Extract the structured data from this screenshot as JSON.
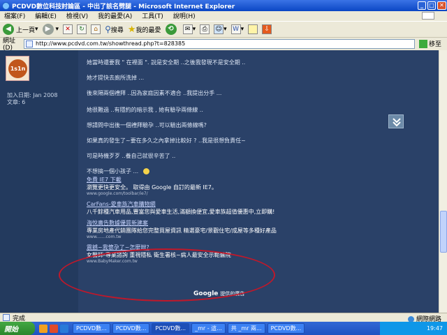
{
  "window": {
    "title": "PCDVD數位科技討論區 - 中出了該名劈腿 - Microsoft Internet Explorer"
  },
  "menu": [
    "檔案(F)",
    "編輯(E)",
    "檢視(V)",
    "我的最愛(A)",
    "工具(T)",
    "說明(H)"
  ],
  "toolbar": {
    "back": "上一頁",
    "search": "搜尋",
    "favorites": "我的最愛"
  },
  "address": {
    "label": "網址(D)",
    "url": "http://www.pcdvd.com.tw/showthread.php?t=828385",
    "go": "移至"
  },
  "user": {
    "join_date": "加入日期: Jan 2008",
    "posts": "文章: 6"
  },
  "post_lines": [
    "她當時還要我 \" 在裡面 \". 說是安全期 ..之後我發現不是安全期 ..",
    "她才提快去廁所洗掉 ...",
    "後來隔兩個禮拜 ..因為家庭因素不適合 ..我提出分手 ...",
    "她很難過 ..有隱約的暗示我 , 她有驗孕兩條線 ..",
    "想請問中出後一個禮拜驗孕 ..可以驗出兩條線嗎?",
    "如果真的發生了~要在多久之內拿掉比較好 ? ..我是很想負責任~",
    "可是時機歹歹 ..養自己就很辛苦了 ..",
    "不想搞一個小孩子 ..."
  ],
  "ads": [
    {
      "headline": "免費 IE7 下載",
      "desc": "瀏覽更快更安全。 取得由 Google 自訂的最新 IE7。",
      "url": "www.google.com/toolbar/ie7/"
    },
    {
      "headline": "CarFans-愛車族汽車購物網",
      "desc": "八千餘種汽車用品,豐富您與愛車生活,滿額換便宜,愛車族超值優惠中,立即購!",
      "url": ""
    },
    {
      "headline": "海悅廣告數據優質新建案",
      "desc": "專業房地產代銷團隊給您完整買屋資訊 精選豪宅/景觀住宅/成屋等多種好產品",
      "url": "www.......com.tw"
    },
    {
      "headline": "震撼~我懷孕了~怎麼辦?",
      "desc": "女醫師-專業諮詢 重視隱私 衛生署核~病人最安全示範醫院",
      "url": "www.BabyMaker.com.tw"
    }
  ],
  "ad_footer": {
    "brand": "Google",
    "text": "提供的廣告"
  },
  "status": {
    "text": "完成",
    "zone": "網際網路"
  },
  "taskbar": {
    "start": "開始",
    "tasks": [
      "PCDVD數...",
      "PCDVD數...",
      "PCDVD數...",
      "_mr - 這...",
      "共 _mr 兩...",
      "PCDVD數..."
    ],
    "clock": "19:47"
  }
}
